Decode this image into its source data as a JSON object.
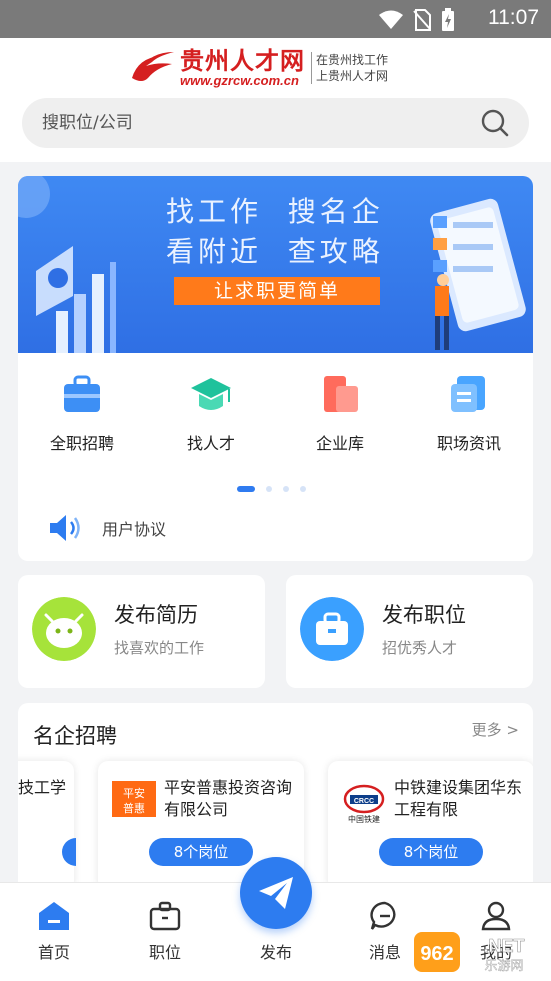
{
  "status_bar": {
    "time": "11:07"
  },
  "header": {
    "logo_cn": "贵州人才网",
    "logo_url": "www.gzrcw.com.cn",
    "slogan_line1": "在贵州找工作",
    "slogan_line2": "上贵州人才网"
  },
  "search": {
    "placeholder": "搜职位/公司"
  },
  "banner": {
    "line1": "找工作  搜名企",
    "line2": "看附近  查攻略",
    "cta": "让求职更简单"
  },
  "categories": [
    {
      "label": "全职招聘",
      "icon": "briefcase-icon"
    },
    {
      "label": "找人才",
      "icon": "graduation-cap-icon"
    },
    {
      "label": "企业库",
      "icon": "company-icon"
    },
    {
      "label": "职场资讯",
      "icon": "news-icon"
    }
  ],
  "pagination": {
    "pages": 4,
    "active": 1
  },
  "notice": {
    "label": "用户协议"
  },
  "publish": {
    "resume_title": "发布简历",
    "resume_sub": "找喜欢的工作",
    "job_title": "发布职位",
    "job_sub": "招优秀人才"
  },
  "famous": {
    "heading": "名企招聘",
    "more": "更多 >",
    "partial_prev": "技工学",
    "companies": [
      {
        "name": "平安普惠投资咨询有限公司",
        "jobs": "8个岗位",
        "logo_text": "平安 普惠"
      },
      {
        "name": "中铁建设集团华东工程有限",
        "jobs": "8个岗位",
        "logo_text": "中国铁建"
      }
    ]
  },
  "tabbar": {
    "home": "首页",
    "jobs": "职位",
    "publish": "发布",
    "messages": "消息",
    "mine": "我的"
  },
  "watermark": {
    "text": "962.NET",
    "sub": "乐游网"
  },
  "colors": {
    "primary": "#2d7cf0",
    "brand_red": "#d51f20",
    "cta_orange": "#ff7a1a"
  }
}
